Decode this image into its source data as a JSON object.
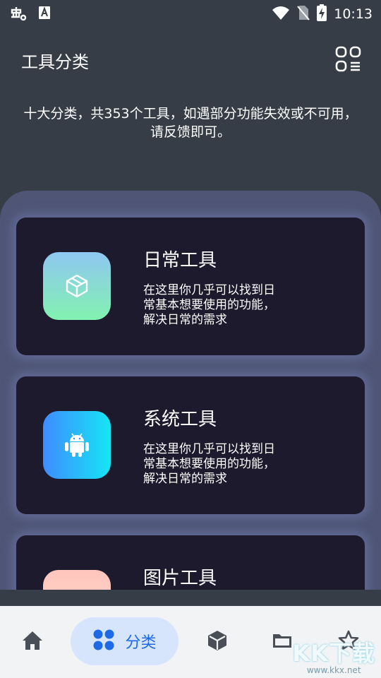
{
  "status_bar": {
    "time": "10:13",
    "icons": [
      "bug-icon",
      "keyboard-a-icon",
      "wifi-icon",
      "no-sim-icon",
      "battery-charging-icon"
    ]
  },
  "header": {
    "title": "工具分类",
    "menu_icon": "grid-menu-icon"
  },
  "description": "十大分类，共353个工具，如遇部分功能失效或不可用，请反馈即可。",
  "cards": [
    {
      "title": "日常工具",
      "desc_lines": [
        "在这里你几乎可以找到日",
        "常基本想要使用的功能，",
        "解决日常的需求"
      ],
      "icon": "cube-outline-icon",
      "gradient": [
        "#8fc7f2",
        "#82f2b0"
      ]
    },
    {
      "title": "系统工具",
      "desc_lines": [
        "在这里你几乎可以找到日",
        "常基本想要使用的功能，",
        "解决日常的需求"
      ],
      "icon": "android-icon",
      "gradient": [
        "#3f8cff",
        "#15e6f4"
      ]
    },
    {
      "title": "图片工具",
      "desc_lines": [],
      "icon": "image-icon",
      "gradient": [
        "#ffb8b0",
        "#ffd2c7"
      ]
    }
  ],
  "bottom_nav": {
    "items": [
      {
        "icon": "home-icon"
      },
      {
        "icon": "apps-grid-icon",
        "label": "分类",
        "active": true
      },
      {
        "icon": "cube-icon"
      },
      {
        "icon": "folder-icon"
      },
      {
        "icon": "star-icon"
      }
    ],
    "active_color": "#1e6ae6",
    "active_bg": "#d6e5fb"
  },
  "watermark": {
    "text": "KK下载",
    "url": "www.kkx.net"
  }
}
